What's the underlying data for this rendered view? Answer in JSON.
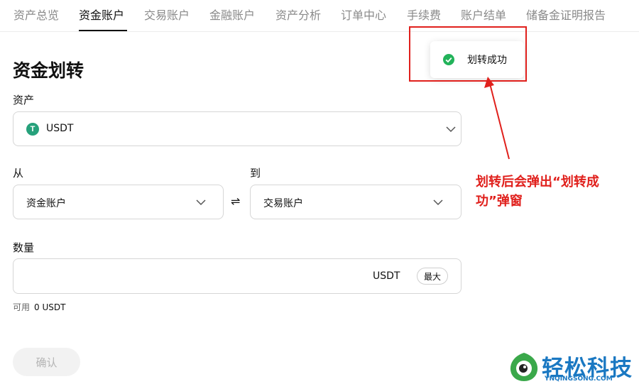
{
  "nav": {
    "tabs": [
      {
        "label": "资产总览"
      },
      {
        "label": "资金账户"
      },
      {
        "label": "交易账户"
      },
      {
        "label": "金融账户"
      },
      {
        "label": "资产分析"
      },
      {
        "label": "订单中心"
      },
      {
        "label": "手续费"
      },
      {
        "label": "账户结单"
      },
      {
        "label": "储备金证明报告"
      }
    ],
    "active_tab": "资金账户"
  },
  "transfer": {
    "title": "资金划转",
    "asset_label": "资产",
    "asset_value": "USDT",
    "asset_icon": "tether-coin-icon",
    "asset_icon_letter": "T",
    "asset_icon_color": "#26a17b",
    "from_label": "从",
    "from_value": "资金账户",
    "to_label": "到",
    "to_value": "交易账户",
    "swap_symbol": "⇌",
    "amount_label": "数量",
    "amount_value": "",
    "amount_unit": "USDT",
    "max_label": "最大",
    "available_label": "可用",
    "available_value": "0 USDT",
    "confirm_label": "确认"
  },
  "toast": {
    "message": "划转成功",
    "icon": "check-circle-icon",
    "icon_color": "#22b35a"
  },
  "annotation": {
    "text": "划转后会弹出“划转成功”弹窗",
    "color": "#e0201c"
  },
  "watermark": {
    "title": "轻松科技",
    "subtitle": "YNQINGSONG.COM",
    "color": "#1a78c2"
  }
}
